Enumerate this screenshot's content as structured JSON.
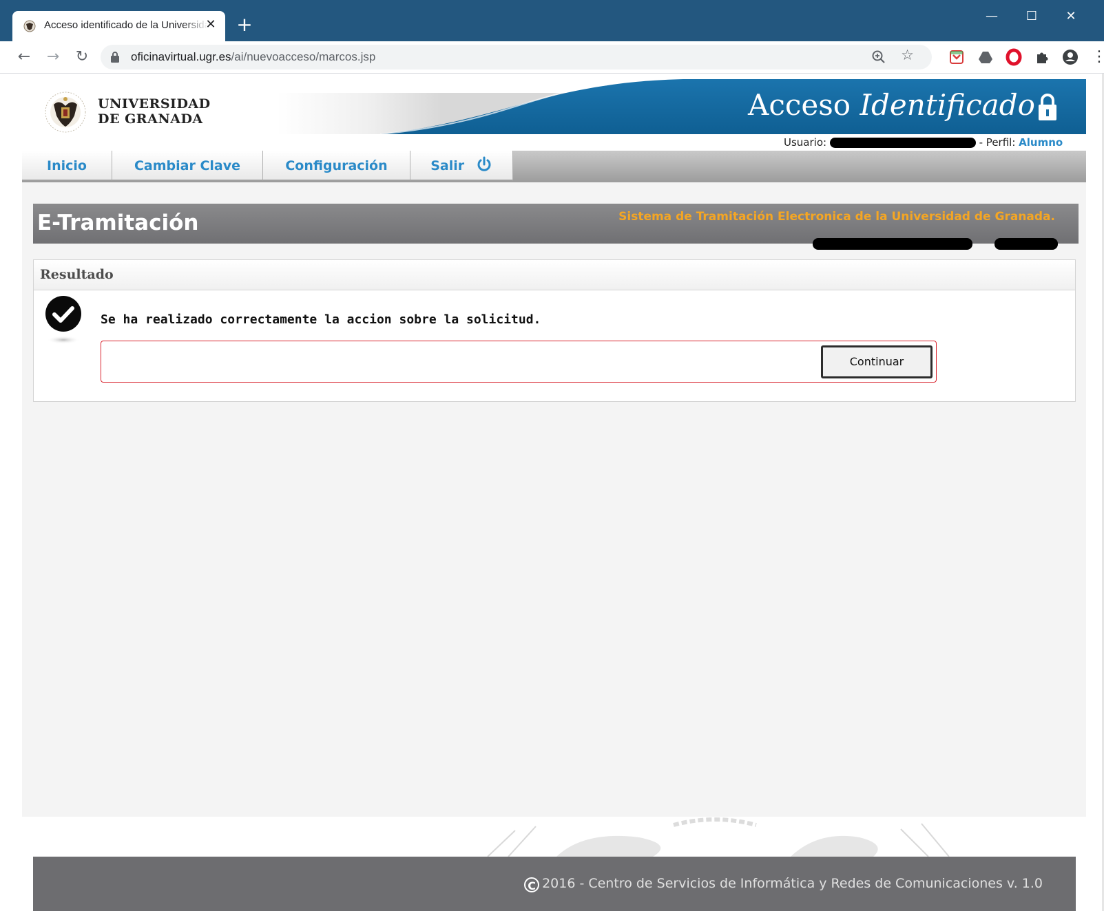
{
  "browser": {
    "tab_title": "Acceso identificado de la Universidad de Granada",
    "tab_close": "✕",
    "new_tab": "+",
    "url_host": "oficinavirtual.ugr.es",
    "url_path": "/ai/nuevoacceso/marcos.jsp",
    "window_minimize": "—",
    "window_maximize": "☐",
    "window_close": "✕"
  },
  "header": {
    "logo_line1": "UNIVERSIDAD",
    "logo_line2": "DE GRANADA",
    "title_plain": "Acceso",
    "title_italic": "Identificado",
    "usuario_label": "Usuario:",
    "perfil_label": "- Perfil:",
    "perfil_value": "Alumno"
  },
  "menu": {
    "items": [
      {
        "label": "Inicio"
      },
      {
        "label": "Cambiar Clave"
      },
      {
        "label": "Configuración"
      },
      {
        "label": "Salir"
      }
    ]
  },
  "banner": {
    "title": "E-Tramitación",
    "subtitle": "Sistema de Tramitación Electronica de la Universidad de Granada."
  },
  "result": {
    "heading": "Resultado",
    "message": "Se ha realizado correctamente la accion sobre la solicitud.",
    "continue_label": "Continuar"
  },
  "footer": {
    "copyright_symbol": "C",
    "text": "2016 - Centro de Servicios de Informática y Redes de Comunicaciones v. 1.0"
  },
  "colors": {
    "chrome_title": "#23577f",
    "brand_blue": "#1a6fa6",
    "link_blue": "#2a8ac8",
    "banner_accent": "#f5a623",
    "action_border": "#d9232d"
  }
}
